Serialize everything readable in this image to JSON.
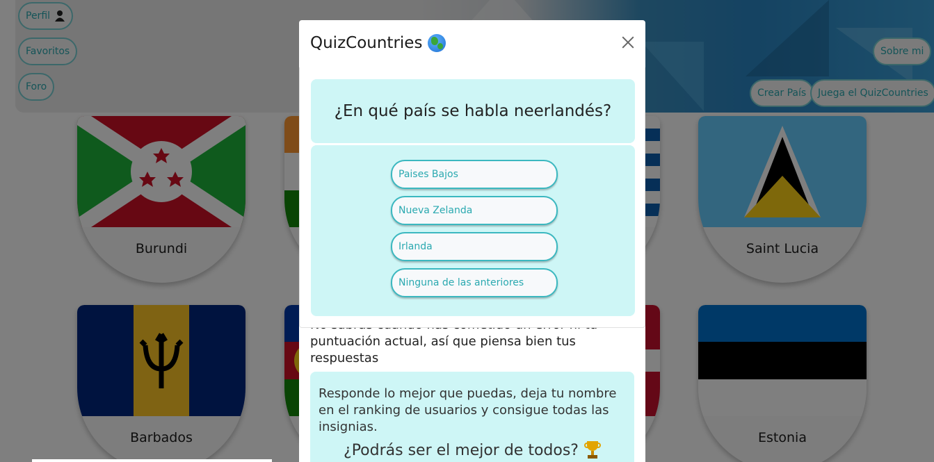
{
  "nav": {
    "left": [
      {
        "label": "Perfil",
        "icon": "user-icon"
      },
      {
        "label": "Favoritos"
      },
      {
        "label": "Foro"
      }
    ],
    "right": {
      "about": "Sobre mi",
      "create_country": "Crear País",
      "play_quiz": "Juega el QuizCountries"
    }
  },
  "countries": [
    {
      "name": "Burundi"
    },
    {
      "name": "Saint Lucia"
    },
    {
      "name": "Barbados"
    },
    {
      "name": "Estonia"
    }
  ],
  "modal": {
    "title": "QuizCountries",
    "title_icon": "globe-icon",
    "question": "¿En qué país se habla neerlandés?",
    "answers": [
      "Paises Bajos",
      "Nueva Zelanda",
      "Irlanda",
      "Ninguna de las anteriores"
    ],
    "note": "No sabrás cuando has cometido un error ni tu puntuación actual, así que piensa bien tus respuestas",
    "info": "Responde lo mejor que puedas, deja tu nombre en el ranking de usuarios y consigue todas las insignias.",
    "challenge": "¿Podrás ser el mejor de todos?",
    "challenge_icon": "trophy-icon"
  },
  "colors": {
    "accent": "#2aa9b0",
    "panel": "#cef6f6",
    "overlay": "rgba(0,0,0,0.5)"
  }
}
